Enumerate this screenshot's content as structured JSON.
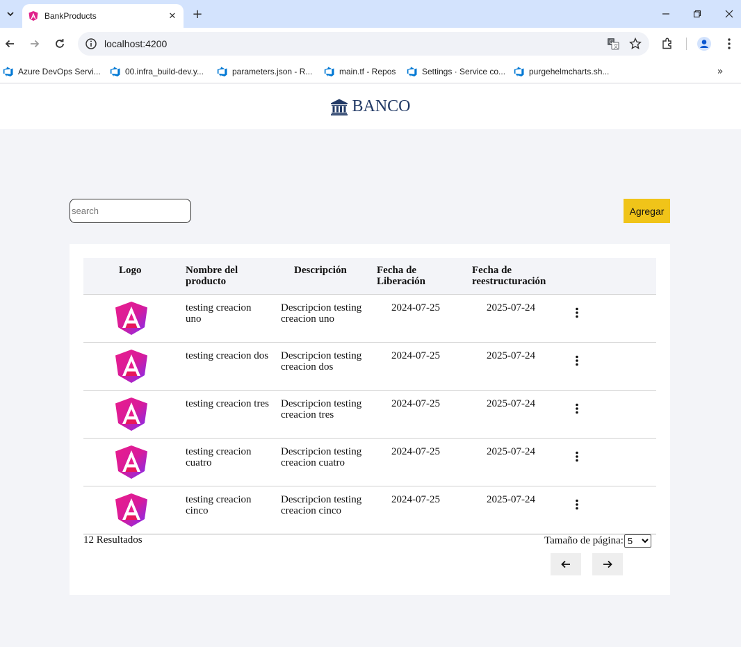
{
  "browser": {
    "tab_title": "BankProducts",
    "url": "localhost:4200",
    "bookmarks": [
      {
        "label": "Azure DevOps Servi..."
      },
      {
        "label": "00.infra_build-dev.y..."
      },
      {
        "label": "parameters.json - R..."
      },
      {
        "label": "main.tf - Repos"
      },
      {
        "label": "Settings · Service co..."
      },
      {
        "label": "purgehelmcharts.sh..."
      }
    ]
  },
  "header": {
    "brand": "BANCO"
  },
  "toolbar": {
    "search_placeholder": "search",
    "search_value": "",
    "add_label": "Agregar"
  },
  "table": {
    "columns": [
      "Logo",
      "Nombre del producto",
      "Descripción",
      "Fecha de Liberación",
      "Fecha de reestructuración"
    ],
    "rows": [
      {
        "name": "testing creacion uno",
        "description": "Descripcion testing creacion uno",
        "release": "2024-07-25",
        "restructure": "2025-07-24"
      },
      {
        "name": "testing creacion dos",
        "description": "Descripcion testing creacion dos",
        "release": "2024-07-25",
        "restructure": "2025-07-24"
      },
      {
        "name": "testing creacion tres",
        "description": "Descripcion testing creacion tres",
        "release": "2024-07-25",
        "restructure": "2025-07-24"
      },
      {
        "name": "testing creacion cuatro",
        "description": "Descripcion testing creacion cuatro",
        "release": "2024-07-25",
        "restructure": "2025-07-24"
      },
      {
        "name": "testing creacion cinco",
        "description": "Descripcion testing creacion cinco",
        "release": "2024-07-25",
        "restructure": "2025-07-24"
      }
    ]
  },
  "footer": {
    "results": "12 Resultados",
    "page_size_label": "Tamaño de página:",
    "page_size_value": "5"
  },
  "colors": {
    "accent": "#f0c419",
    "brand": "#223a66",
    "page_bg": "#f3f4f8"
  }
}
